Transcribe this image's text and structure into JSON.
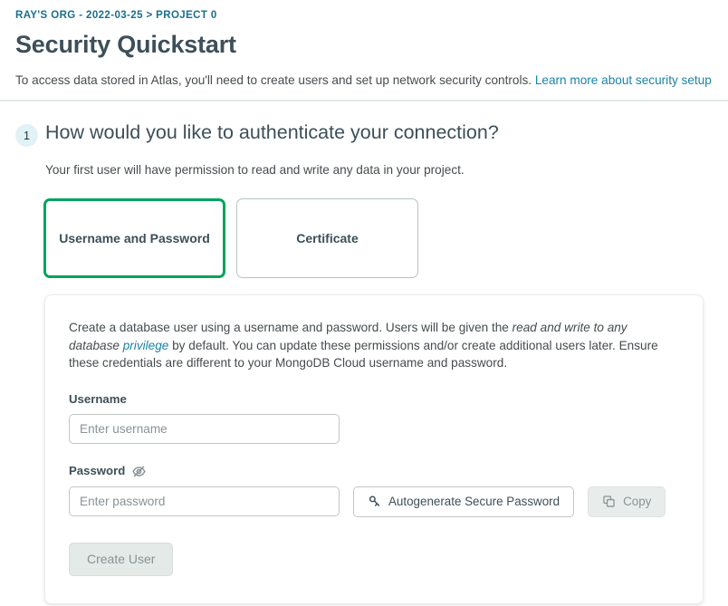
{
  "header": {
    "breadcrumb": "RAY'S ORG - 2022-03-25 > PROJECT 0",
    "title": "Security Quickstart",
    "intro_text": "To access data stored in Atlas, you'll need to create users and set up network security controls.",
    "intro_link": "Learn more about security setup"
  },
  "step": {
    "number": "1",
    "question": "How would you like to authenticate your connection?",
    "subtitle": "Your first user will have permission to read and write any data in your project."
  },
  "auth_options": [
    {
      "label": "Username and Password",
      "selected": true
    },
    {
      "label": "Certificate",
      "selected": false
    }
  ],
  "panel": {
    "desc_part1": "Create a database user using a username and password. Users will be given the ",
    "desc_italic": "read and write to any database",
    "desc_link": "privilege",
    "desc_part2": " by default. You can update these permissions and/or create additional users later. Ensure these credentials are different to your MongoDB Cloud username and password.",
    "username_label": "Username",
    "username_value": "",
    "username_placeholder": "Enter username",
    "password_label": "Password",
    "password_value": "",
    "password_placeholder": "Enter password",
    "password_visibility_icon": "eye-off-icon",
    "autogenerate_label": "Autogenerate Secure Password",
    "autogenerate_icon": "key-icon",
    "copy_label": "Copy",
    "copy_icon": "copy-icon",
    "create_user_label": "Create User"
  },
  "colors": {
    "accent_green": "#00a35c",
    "link_blue": "#1a83a8",
    "breadcrumb_blue": "#1a6f8c",
    "badge_bg": "#e1f2f6",
    "text": "#3d4f58"
  }
}
